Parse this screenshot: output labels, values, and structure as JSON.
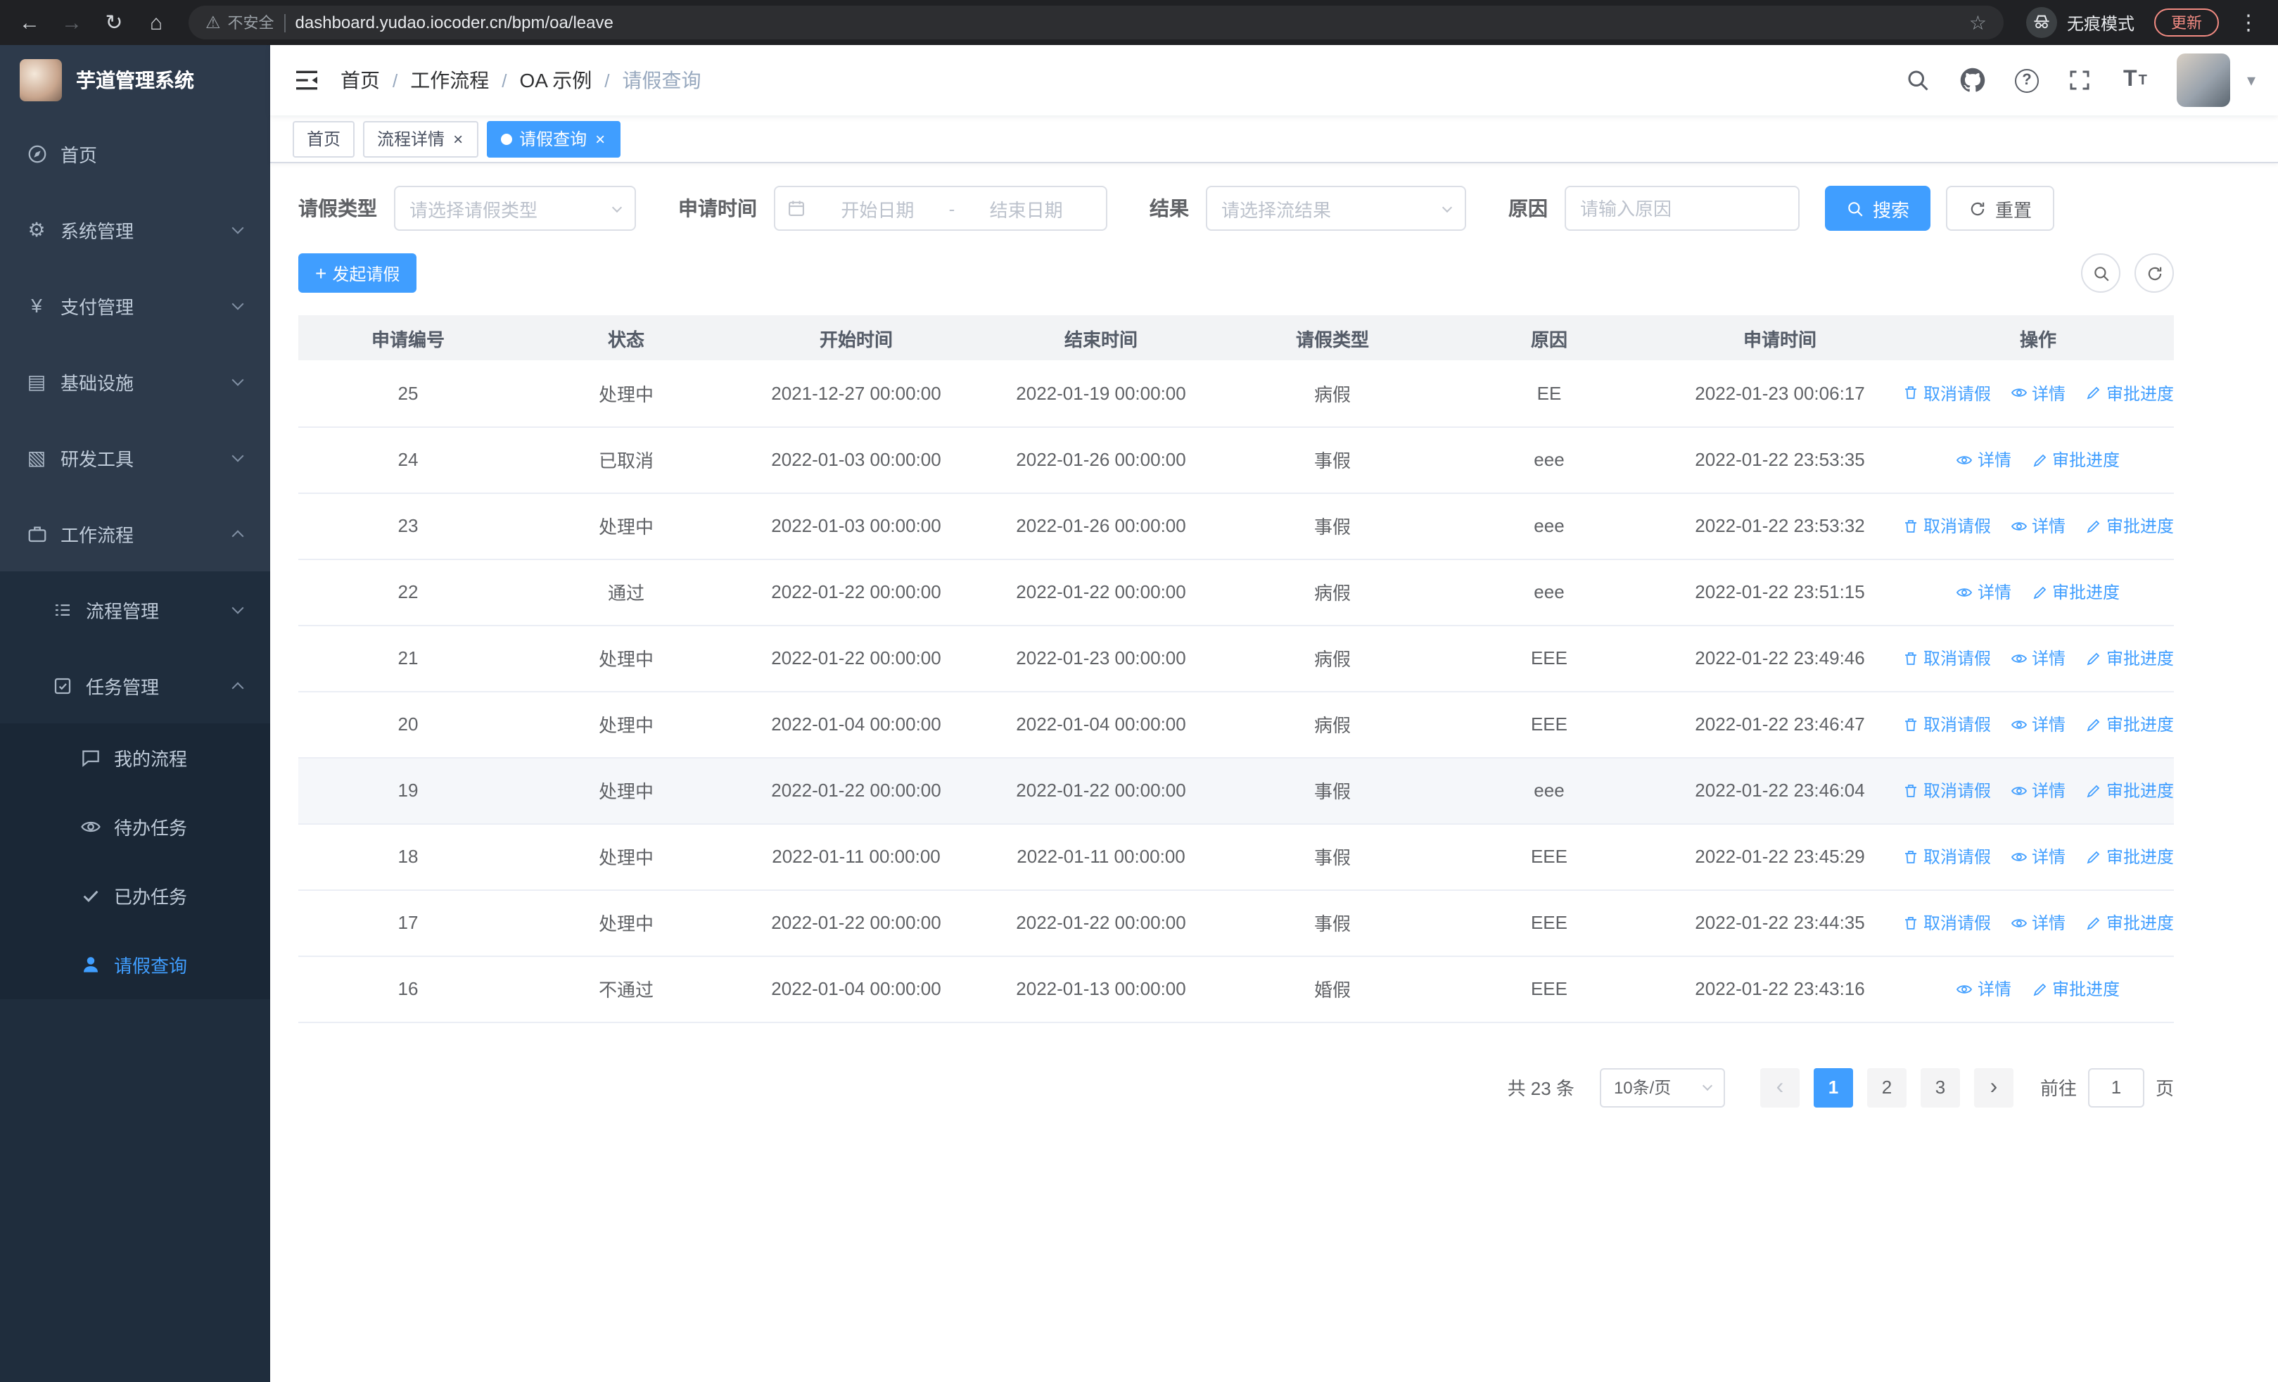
{
  "accent_color": "#409EFF",
  "browser": {
    "security_warning": "不安全",
    "url": "dashboard.yudao.iocoder.cn/bpm/oa/leave",
    "incognito_label": "无痕模式",
    "update_label": "更新"
  },
  "sidebar": {
    "logo_title": "芋道管理系统",
    "items": [
      {
        "key": "home",
        "label": "首页",
        "level": 1,
        "icon": "home-icon",
        "svg": "i-compass"
      },
      {
        "key": "system",
        "label": "系统管理",
        "level": 1,
        "icon": "gear-icon",
        "glyph": "⚙",
        "arrow": "down"
      },
      {
        "key": "payment",
        "label": "支付管理",
        "level": 1,
        "icon": "yen-icon",
        "glyph": "¥",
        "arrow": "down"
      },
      {
        "key": "infrastructure",
        "label": "基础设施",
        "level": 1,
        "icon": "infrastructure-icon",
        "glyph": "▤",
        "arrow": "down"
      },
      {
        "key": "devtools",
        "label": "研发工具",
        "level": 1,
        "icon": "tools-icon",
        "glyph": "▧",
        "arrow": "down"
      },
      {
        "key": "workflow",
        "label": "工作流程",
        "level": 1,
        "icon": "briefcase-icon",
        "svg": "i-briefcase",
        "arrow": "up"
      },
      {
        "key": "process-mgmt",
        "label": "流程管理",
        "level": 2,
        "icon": "list-icon",
        "svg": "i-list",
        "arrow": "down"
      },
      {
        "key": "task-mgmt",
        "label": "任务管理",
        "level": 2,
        "icon": "tasks-icon",
        "svg": "i-tasks",
        "arrow": "up"
      },
      {
        "key": "my-process",
        "label": "我的流程",
        "level": 3,
        "icon": "chat-icon",
        "svg": "i-chat"
      },
      {
        "key": "todo-tasks",
        "label": "待办任务",
        "level": 3,
        "icon": "eye-icon",
        "svg": "i-eye"
      },
      {
        "key": "done-tasks",
        "label": "已办任务",
        "level": 3,
        "icon": "check-icon",
        "svg": "i-check"
      },
      {
        "key": "leave-query",
        "label": "请假查询",
        "level": 3,
        "icon": "user-icon",
        "svg": "i-person",
        "active": true
      }
    ]
  },
  "navbar": {
    "breadcrumb": [
      "首页",
      "工作流程",
      "OA 示例",
      "请假查询"
    ]
  },
  "tabs": [
    {
      "key": "tab-home",
      "label": "首页",
      "active": false,
      "closable": false,
      "dot": false
    },
    {
      "key": "tab-process-detail",
      "label": "流程详情",
      "active": false,
      "closable": true,
      "dot": false
    },
    {
      "key": "tab-leave-query",
      "label": "请假查询",
      "active": true,
      "closable": true,
      "dot": true
    }
  ],
  "filters": {
    "leave_type": {
      "label": "请假类型",
      "placeholder": "请选择请假类型"
    },
    "apply_time": {
      "label": "申请时间",
      "start_placeholder": "开始日期",
      "separator": "-",
      "end_placeholder": "结束日期"
    },
    "result": {
      "label": "结果",
      "placeholder": "请选择流结果"
    },
    "reason": {
      "label": "原因",
      "placeholder": "请输入原因"
    },
    "search_label": "搜索",
    "reset_label": "重置"
  },
  "toolbar": {
    "create_label": "发起请假"
  },
  "table": {
    "columns": [
      "申请编号",
      "状态",
      "开始时间",
      "结束时间",
      "请假类型",
      "原因",
      "申请时间",
      "操作"
    ],
    "action_labels": {
      "cancel": "取消请假",
      "detail": "详情",
      "progress": "审批进度"
    },
    "rows": [
      {
        "id": "25",
        "status": "处理中",
        "start_time": "2021-12-27 00:00:00",
        "end_time": "2022-01-19 00:00:00",
        "leave_type": "病假",
        "reason": "EE",
        "apply_time": "2022-01-23 00:06:17",
        "actions": [
          "cancel",
          "detail",
          "progress"
        ]
      },
      {
        "id": "24",
        "status": "已取消",
        "start_time": "2022-01-03 00:00:00",
        "end_time": "2022-01-26 00:00:00",
        "leave_type": "事假",
        "reason": "eee",
        "apply_time": "2022-01-22 23:53:35",
        "actions": [
          "detail",
          "progress"
        ]
      },
      {
        "id": "23",
        "status": "处理中",
        "start_time": "2022-01-03 00:00:00",
        "end_time": "2022-01-26 00:00:00",
        "leave_type": "事假",
        "reason": "eee",
        "apply_time": "2022-01-22 23:53:32",
        "actions": [
          "cancel",
          "detail",
          "progress"
        ]
      },
      {
        "id": "22",
        "status": "通过",
        "start_time": "2022-01-22 00:00:00",
        "end_time": "2022-01-22 00:00:00",
        "leave_type": "病假",
        "reason": "eee",
        "apply_time": "2022-01-22 23:51:15",
        "actions": [
          "detail",
          "progress"
        ]
      },
      {
        "id": "21",
        "status": "处理中",
        "start_time": "2022-01-22 00:00:00",
        "end_time": "2022-01-23 00:00:00",
        "leave_type": "病假",
        "reason": "EEE",
        "apply_time": "2022-01-22 23:49:46",
        "actions": [
          "cancel",
          "detail",
          "progress"
        ]
      },
      {
        "id": "20",
        "status": "处理中",
        "start_time": "2022-01-04 00:00:00",
        "end_time": "2022-01-04 00:00:00",
        "leave_type": "病假",
        "reason": "EEE",
        "apply_time": "2022-01-22 23:46:47",
        "actions": [
          "cancel",
          "detail",
          "progress"
        ]
      },
      {
        "id": "19",
        "status": "处理中",
        "start_time": "2022-01-22 00:00:00",
        "end_time": "2022-01-22 00:00:00",
        "leave_type": "事假",
        "reason": "eee",
        "apply_time": "2022-01-22 23:46:04",
        "actions": [
          "cancel",
          "detail",
          "progress"
        ],
        "highlighted": true
      },
      {
        "id": "18",
        "status": "处理中",
        "start_time": "2022-01-11 00:00:00",
        "end_time": "2022-01-11 00:00:00",
        "leave_type": "事假",
        "reason": "EEE",
        "apply_time": "2022-01-22 23:45:29",
        "actions": [
          "cancel",
          "detail",
          "progress"
        ]
      },
      {
        "id": "17",
        "status": "处理中",
        "start_time": "2022-01-22 00:00:00",
        "end_time": "2022-01-22 00:00:00",
        "leave_type": "事假",
        "reason": "EEE",
        "apply_time": "2022-01-22 23:44:35",
        "actions": [
          "cancel",
          "detail",
          "progress"
        ]
      },
      {
        "id": "16",
        "status": "不通过",
        "start_time": "2022-01-04 00:00:00",
        "end_time": "2022-01-13 00:00:00",
        "leave_type": "婚假",
        "reason": "EEE",
        "apply_time": "2022-01-22 23:43:16",
        "actions": [
          "detail",
          "progress"
        ]
      }
    ]
  },
  "pagination": {
    "total_text": "共 23 条",
    "page_size_text": "10条/页",
    "pages": [
      "1",
      "2",
      "3"
    ],
    "current_page": "1",
    "goto_label": "前往",
    "goto_value": "1",
    "page_unit": "页"
  }
}
